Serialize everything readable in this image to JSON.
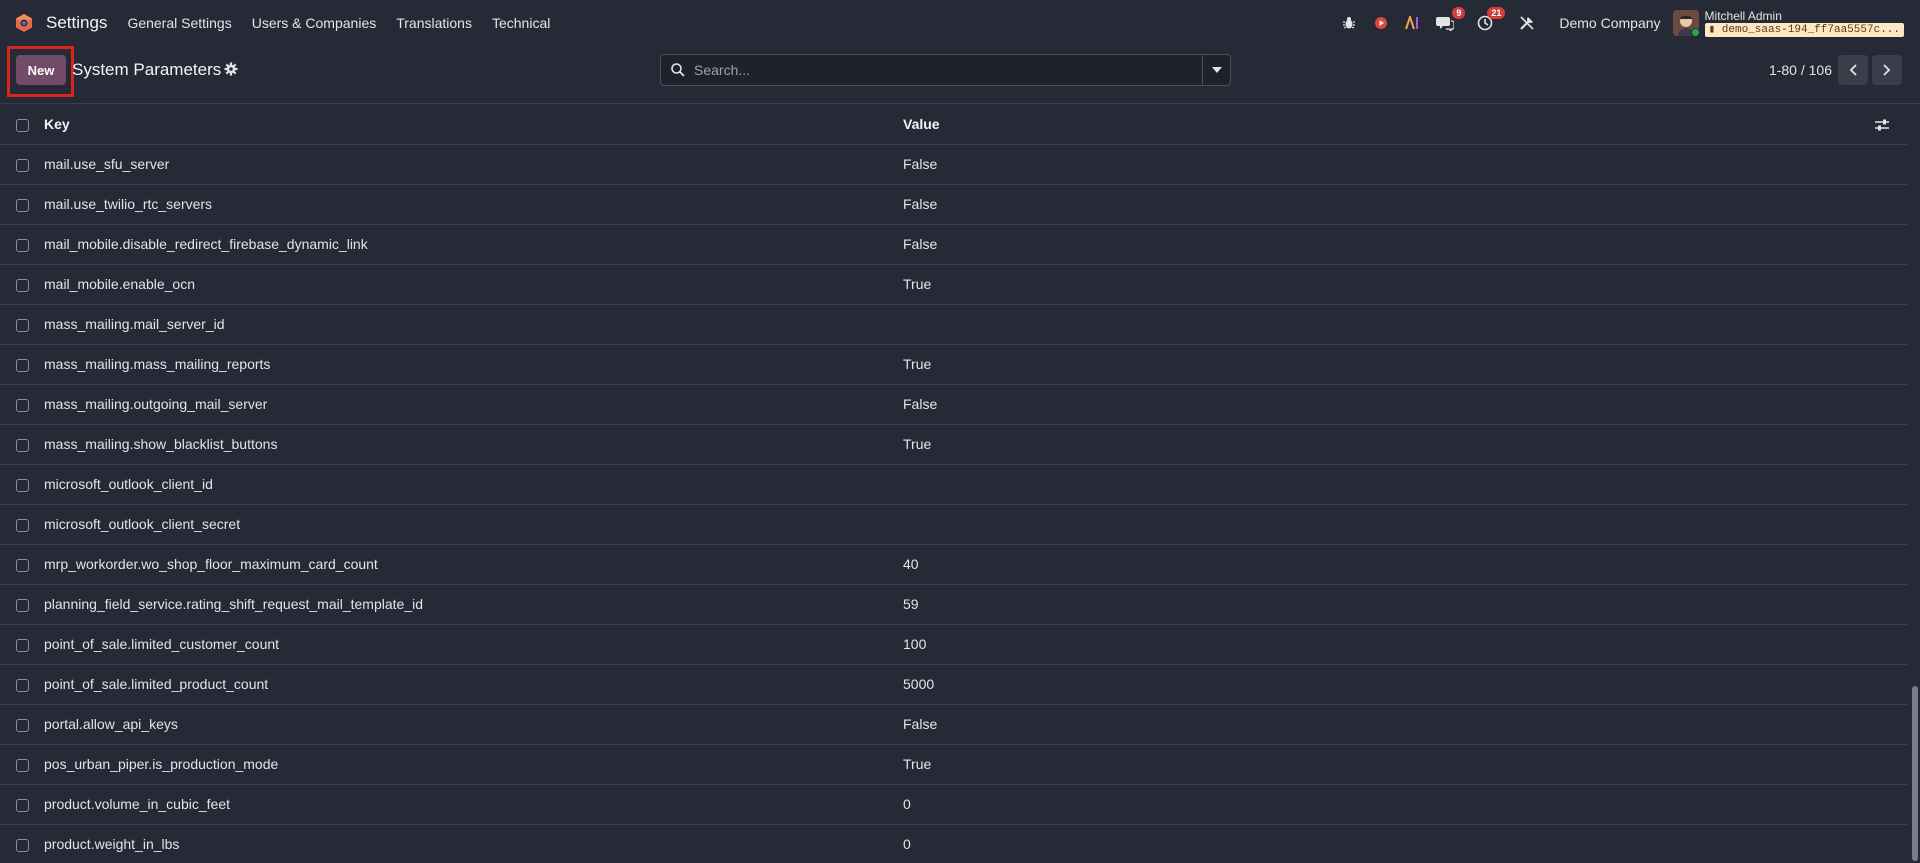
{
  "navbar": {
    "app_title": "Settings",
    "menu": [
      "General Settings",
      "Users & Companies",
      "Translations",
      "Technical"
    ],
    "messages_count": "9",
    "activities_count": "21",
    "company": "Demo Company",
    "user_name": "Mitchell Admin",
    "db_name": "demo_saas-194_ff7aa5557c..."
  },
  "control": {
    "new_label": "New",
    "title": "System Parameters",
    "search_placeholder": "Search...",
    "pager": "1-80 / 106"
  },
  "table": {
    "columns": {
      "key": "Key",
      "value": "Value"
    },
    "rows": [
      {
        "key": "mail.use_sfu_server",
        "value": "False"
      },
      {
        "key": "mail.use_twilio_rtc_servers",
        "value": "False"
      },
      {
        "key": "mail_mobile.disable_redirect_firebase_dynamic_link",
        "value": "False"
      },
      {
        "key": "mail_mobile.enable_ocn",
        "value": "True"
      },
      {
        "key": "mass_mailing.mail_server_id",
        "value": ""
      },
      {
        "key": "mass_mailing.mass_mailing_reports",
        "value": "True"
      },
      {
        "key": "mass_mailing.outgoing_mail_server",
        "value": "False"
      },
      {
        "key": "mass_mailing.show_blacklist_buttons",
        "value": "True"
      },
      {
        "key": "microsoft_outlook_client_id",
        "value": ""
      },
      {
        "key": "microsoft_outlook_client_secret",
        "value": ""
      },
      {
        "key": "mrp_workorder.wo_shop_floor_maximum_card_count",
        "value": "40"
      },
      {
        "key": "planning_field_service.rating_shift_request_mail_template_id",
        "value": "59"
      },
      {
        "key": "point_of_sale.limited_customer_count",
        "value": "100"
      },
      {
        "key": "point_of_sale.limited_product_count",
        "value": "5000"
      },
      {
        "key": "portal.allow_api_keys",
        "value": "False"
      },
      {
        "key": "pos_urban_piper.is_production_mode",
        "value": "True"
      },
      {
        "key": "product.volume_in_cubic_feet",
        "value": "0"
      },
      {
        "key": "product.weight_in_lbs",
        "value": "0"
      }
    ]
  },
  "colors": {
    "background": "#262a36",
    "primary": "#714b67",
    "highlight": "#d9261c",
    "badge": "#d23f3a"
  }
}
